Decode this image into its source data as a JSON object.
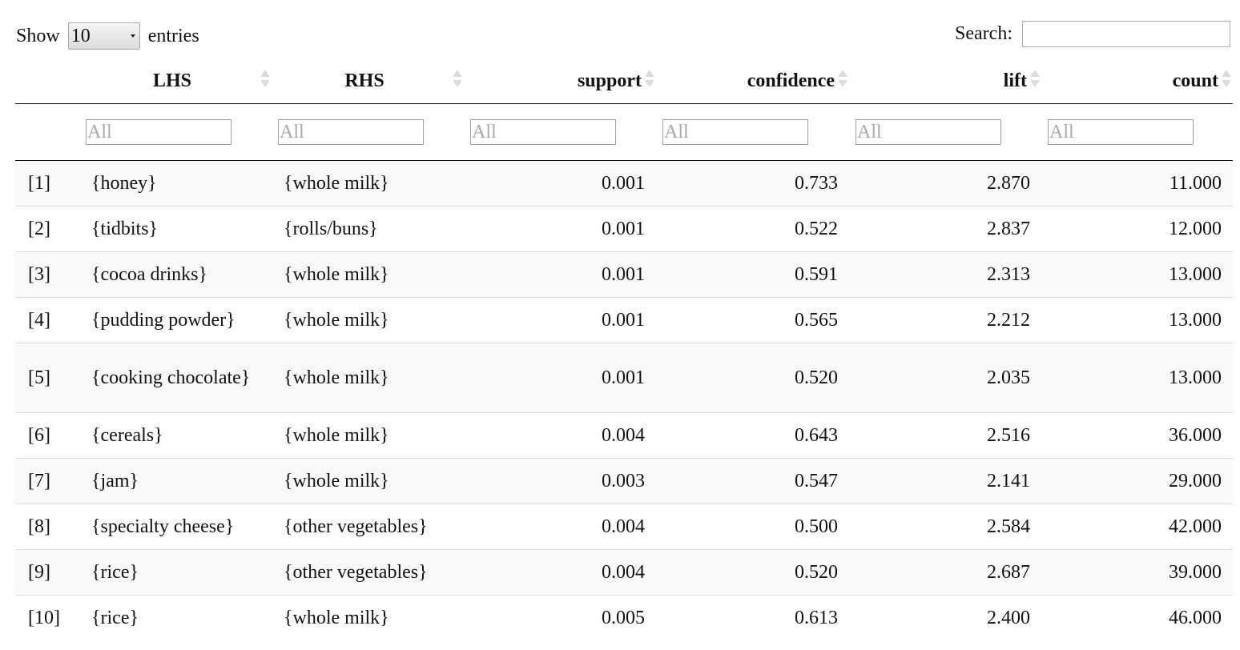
{
  "controls": {
    "show_label": "Show",
    "length_value": "10",
    "entries_label": "entries",
    "search_label": "Search:",
    "search_value": ""
  },
  "columns": [
    "",
    "LHS",
    "RHS",
    "support",
    "confidence",
    "lift",
    "count"
  ],
  "filter_placeholder": "All",
  "rows": [
    {
      "idx": "[1]",
      "lhs": "{honey}",
      "rhs": "{whole milk}",
      "support": "0.001",
      "confidence": "0.733",
      "lift": "2.870",
      "count": "11.000"
    },
    {
      "idx": "[2]",
      "lhs": "{tidbits}",
      "rhs": "{rolls/buns}",
      "support": "0.001",
      "confidence": "0.522",
      "lift": "2.837",
      "count": "12.000"
    },
    {
      "idx": "[3]",
      "lhs": "{cocoa drinks}",
      "rhs": "{whole milk}",
      "support": "0.001",
      "confidence": "0.591",
      "lift": "2.313",
      "count": "13.000"
    },
    {
      "idx": "[4]",
      "lhs": "{pudding powder}",
      "rhs": "{whole milk}",
      "support": "0.001",
      "confidence": "0.565",
      "lift": "2.212",
      "count": "13.000"
    },
    {
      "idx": "[5]",
      "lhs": "{cooking chocolate}",
      "rhs": "{whole milk}",
      "support": "0.001",
      "confidence": "0.520",
      "lift": "2.035",
      "count": "13.000"
    },
    {
      "idx": "[6]",
      "lhs": "{cereals}",
      "rhs": "{whole milk}",
      "support": "0.004",
      "confidence": "0.643",
      "lift": "2.516",
      "count": "36.000"
    },
    {
      "idx": "[7]",
      "lhs": "{jam}",
      "rhs": "{whole milk}",
      "support": "0.003",
      "confidence": "0.547",
      "lift": "2.141",
      "count": "29.000"
    },
    {
      "idx": "[8]",
      "lhs": "{specialty cheese}",
      "rhs": "{other vegetables}",
      "support": "0.004",
      "confidence": "0.500",
      "lift": "2.584",
      "count": "42.000"
    },
    {
      "idx": "[9]",
      "lhs": "{rice}",
      "rhs": "{other vegetables}",
      "support": "0.004",
      "confidence": "0.520",
      "lift": "2.687",
      "count": "39.000"
    },
    {
      "idx": "[10]",
      "lhs": "{rice}",
      "rhs": "{whole milk}",
      "support": "0.005",
      "confidence": "0.613",
      "lift": "2.400",
      "count": "46.000"
    }
  ]
}
